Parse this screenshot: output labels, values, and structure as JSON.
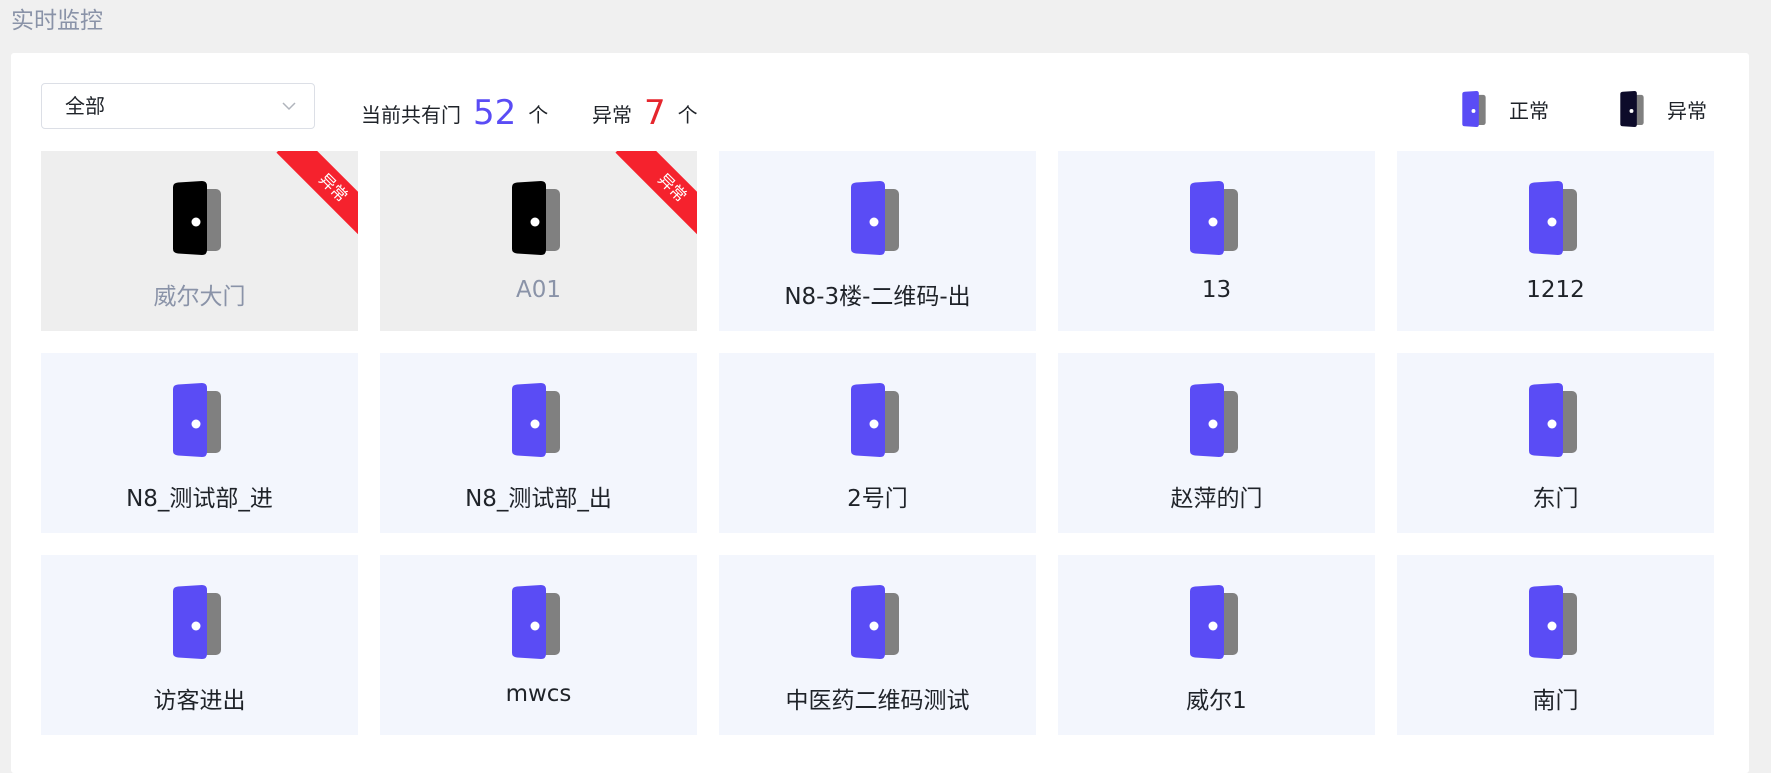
{
  "page": {
    "title": "实时监控"
  },
  "filter": {
    "selected": "全部"
  },
  "stats": {
    "total_prefix": "当前共有门",
    "total_count": "52",
    "total_unit": "个",
    "abnormal_prefix": "异常",
    "abnormal_count": "7",
    "abnormal_unit": "个"
  },
  "legend": {
    "normal_label": "正常",
    "abnormal_label": "异常"
  },
  "colors": {
    "normal_door": "#5a4cf5",
    "abnormal_door": "#000000",
    "accent": "#5a4cf5",
    "alert": "#e5262d"
  },
  "doors": [
    {
      "name": "威尔大门",
      "status": "abnormal",
      "badge": "异常"
    },
    {
      "name": "A01",
      "status": "abnormal",
      "badge": "异常"
    },
    {
      "name": "N8-3楼-二维码-出",
      "status": "normal"
    },
    {
      "name": "13",
      "status": "normal"
    },
    {
      "name": "1212",
      "status": "normal"
    },
    {
      "name": "N8_测试部_进",
      "status": "normal"
    },
    {
      "name": "N8_测试部_出",
      "status": "normal"
    },
    {
      "name": "2号门",
      "status": "normal"
    },
    {
      "name": "赵萍的门",
      "status": "normal"
    },
    {
      "name": "东门",
      "status": "normal"
    },
    {
      "name": "访客进出",
      "status": "normal"
    },
    {
      "name": "mwcs",
      "status": "normal"
    },
    {
      "name": "中医药二维码测试",
      "status": "normal"
    },
    {
      "name": "威尔1",
      "status": "normal"
    },
    {
      "name": "南门",
      "status": "normal"
    }
  ]
}
